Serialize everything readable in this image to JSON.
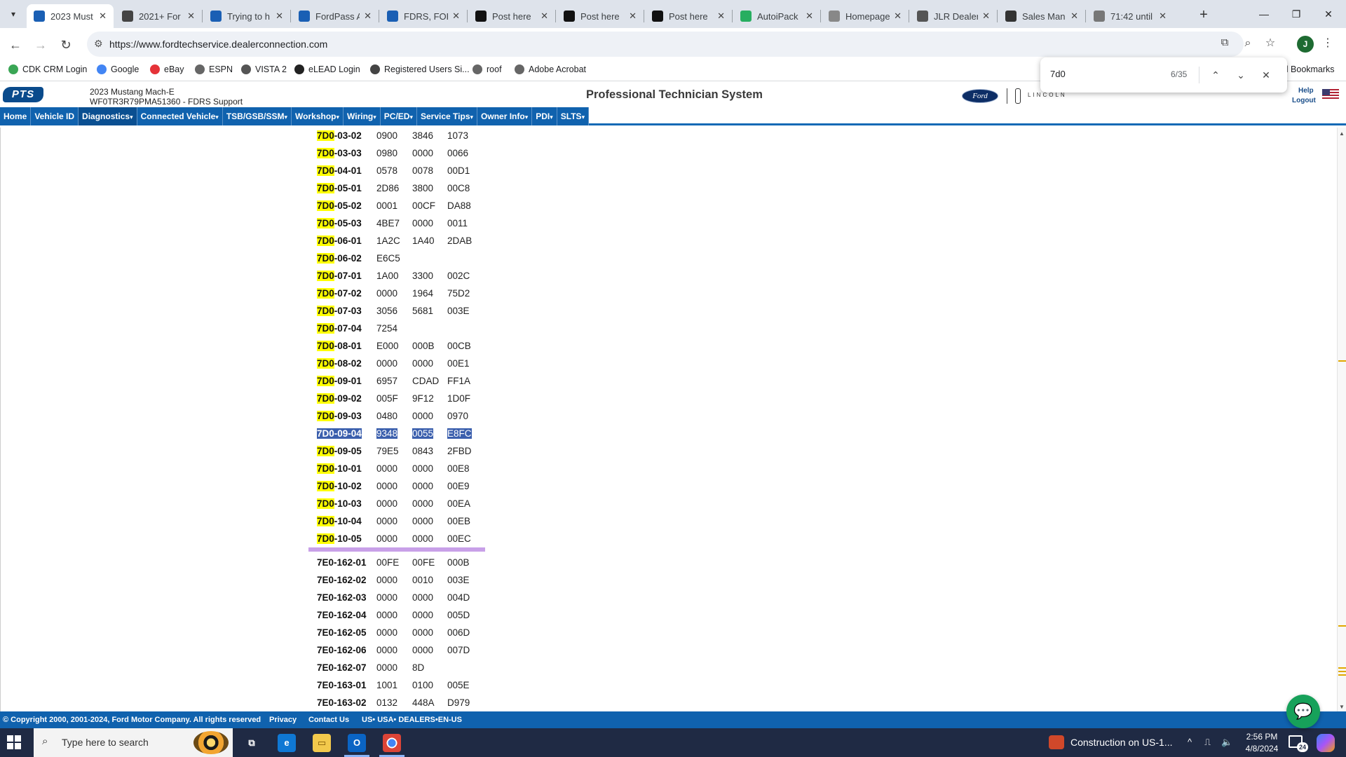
{
  "browser": {
    "tabs": [
      {
        "title": "2023 Must",
        "favicon": "pts-icon",
        "color": "#1a5fb4",
        "active": true
      },
      {
        "title": "2021+ For",
        "favicon": "document-icon",
        "color": "#444444"
      },
      {
        "title": "Trying to h",
        "favicon": "forum-icon",
        "color": "#1a5fb4"
      },
      {
        "title": "FordPass A",
        "favicon": "pts-icon",
        "color": "#1a5fb4"
      },
      {
        "title": "FDRS, FOR",
        "favicon": "pts-icon",
        "color": "#1a5fb4"
      },
      {
        "title": "Post here",
        "favicon": "forum-icon",
        "color": "#111111"
      },
      {
        "title": "Post here",
        "favicon": "forum-icon",
        "color": "#111111"
      },
      {
        "title": "Post here",
        "favicon": "forum-icon",
        "color": "#111111"
      },
      {
        "title": "AutoiPack",
        "favicon": "autoipacket-icon",
        "color": "#27ae60"
      },
      {
        "title": "Homepage",
        "favicon": "jlr-icon",
        "color": "#888888"
      },
      {
        "title": "JLR Dealer",
        "favicon": "globe-icon",
        "color": "#555555"
      },
      {
        "title": "Sales Man",
        "favicon": "grid-icon",
        "color": "#333333"
      },
      {
        "title": "71:42 until",
        "favicon": "timer-icon",
        "color": "#777777"
      }
    ],
    "url": "https://www.fordtechservice.dealerconnection.com",
    "profile_initial": "J",
    "bookmarks": [
      {
        "label": "CDK CRM Login",
        "icon": "cdk-icon",
        "color": "#3aa655"
      },
      {
        "label": "Google",
        "icon": "google-icon",
        "color": "#4285f4"
      },
      {
        "label": "eBay",
        "icon": "ebay-icon",
        "color": "#e53238"
      },
      {
        "label": "ESPN",
        "icon": "globe-icon",
        "color": "#666666"
      },
      {
        "label": "VISTA 2",
        "icon": "vista-icon",
        "color": "#555555"
      },
      {
        "label": "eLEAD Login",
        "icon": "elead-icon",
        "color": "#222222"
      },
      {
        "label": "Registered Users Si...",
        "icon": "arrow-icon",
        "color": "#444444"
      },
      {
        "label": "roof",
        "icon": "globe-icon",
        "color": "#666666"
      },
      {
        "label": "Adobe Acrobat",
        "icon": "globe-icon",
        "color": "#666666"
      }
    ],
    "all_bookmarks": "ll Bookmarks",
    "find": {
      "query": "7d0",
      "count": "6/35"
    }
  },
  "pts": {
    "logo": "PTS",
    "vehicle_name": "2023 Mustang Mach-E",
    "vehicle_vin": "WF0TR3R79PMA51360 - FDRS Support",
    "title": "Professional Technician System",
    "ford_logo": "Ford",
    "lincoln_logo": "LINCOLN",
    "help": "Help",
    "logout": "Logout",
    "menu": [
      {
        "label": "Home",
        "selected": false
      },
      {
        "label": "Vehicle ID",
        "selected": false
      },
      {
        "label": "Diagnostics",
        "selected": true
      },
      {
        "label": "Connected Vehicle",
        "selected": false
      },
      {
        "label": "TSB/GSB/SSM",
        "selected": false
      },
      {
        "label": "Workshop",
        "selected": false
      },
      {
        "label": "Wiring",
        "selected": false
      },
      {
        "label": "PC/ED",
        "selected": false
      },
      {
        "label": "Service Tips",
        "selected": false
      },
      {
        "label": "Owner Info",
        "selected": false
      },
      {
        "label": "PDI",
        "selected": false
      },
      {
        "label": "SLTS",
        "selected": false
      }
    ],
    "menu_dropdown_marker": "▾"
  },
  "data_rows": [
    {
      "prefix": "7D0",
      "suffix": "-03-02",
      "vals": [
        "0900",
        "3846",
        "1073"
      ]
    },
    {
      "prefix": "7D0",
      "suffix": "-03-03",
      "vals": [
        "0980",
        "0000",
        "0066"
      ]
    },
    {
      "prefix": "7D0",
      "suffix": "-04-01",
      "vals": [
        "0578",
        "0078",
        "00D1"
      ]
    },
    {
      "prefix": "7D0",
      "suffix": "-05-01",
      "vals": [
        "2D86",
        "3800",
        "00C8"
      ]
    },
    {
      "prefix": "7D0",
      "suffix": "-05-02",
      "vals": [
        "0001",
        "00CF",
        "DA88"
      ]
    },
    {
      "prefix": "7D0",
      "suffix": "-05-03",
      "vals": [
        "4BE7",
        "0000",
        "0011"
      ]
    },
    {
      "prefix": "7D0",
      "suffix": "-06-01",
      "vals": [
        "1A2C",
        "1A40",
        "2DAB"
      ]
    },
    {
      "prefix": "7D0",
      "suffix": "-06-02",
      "vals": [
        "E6C5"
      ]
    },
    {
      "prefix": "7D0",
      "suffix": "-07-01",
      "vals": [
        "1A00",
        "3300",
        "002C"
      ]
    },
    {
      "prefix": "7D0",
      "suffix": "-07-02",
      "vals": [
        "0000",
        "1964",
        "75D2"
      ]
    },
    {
      "prefix": "7D0",
      "suffix": "-07-03",
      "vals": [
        "3056",
        "5681",
        "003E"
      ]
    },
    {
      "prefix": "7D0",
      "suffix": "-07-04",
      "vals": [
        "7254"
      ]
    },
    {
      "prefix": "7D0",
      "suffix": "-08-01",
      "vals": [
        "E000",
        "000B",
        "00CB"
      ]
    },
    {
      "prefix": "7D0",
      "suffix": "-08-02",
      "vals": [
        "0000",
        "0000",
        "00E1"
      ]
    },
    {
      "prefix": "7D0",
      "suffix": "-09-01",
      "vals": [
        "6957",
        "CDAD",
        "FF1A"
      ]
    },
    {
      "prefix": "7D0",
      "suffix": "-09-02",
      "vals": [
        "005F",
        "9F12",
        "1D0F"
      ]
    },
    {
      "prefix": "7D0",
      "suffix": "-09-03",
      "vals": [
        "0480",
        "0000",
        "0970"
      ]
    },
    {
      "prefix": "7D0",
      "suffix": "-09-04",
      "vals": [
        "9348",
        "0055",
        "E8FC"
      ],
      "current": true
    },
    {
      "prefix": "7D0",
      "suffix": "-09-05",
      "vals": [
        "79E5",
        "0843",
        "2FBD"
      ]
    },
    {
      "prefix": "7D0",
      "suffix": "-10-01",
      "vals": [
        "0000",
        "0000",
        "00E8"
      ]
    },
    {
      "prefix": "7D0",
      "suffix": "-10-02",
      "vals": [
        "0000",
        "0000",
        "00E9"
      ]
    },
    {
      "prefix": "7D0",
      "suffix": "-10-03",
      "vals": [
        "0000",
        "0000",
        "00EA"
      ]
    },
    {
      "prefix": "7D0",
      "suffix": "-10-04",
      "vals": [
        "0000",
        "0000",
        "00EB"
      ]
    },
    {
      "prefix": "7D0",
      "suffix": "-10-05",
      "vals": [
        "0000",
        "0000",
        "00EC"
      ]
    },
    {
      "prefix": "",
      "suffix": "7E0-162-01",
      "vals": [
        "00FE",
        "00FE",
        "000B"
      ],
      "after_divider": true
    },
    {
      "prefix": "",
      "suffix": "7E0-162-02",
      "vals": [
        "0000",
        "0010",
        "003E"
      ]
    },
    {
      "prefix": "",
      "suffix": "7E0-162-03",
      "vals": [
        "0000",
        "0000",
        "004D"
      ]
    },
    {
      "prefix": "",
      "suffix": "7E0-162-04",
      "vals": [
        "0000",
        "0000",
        "005D"
      ]
    },
    {
      "prefix": "",
      "suffix": "7E0-162-05",
      "vals": [
        "0000",
        "0000",
        "006D"
      ]
    },
    {
      "prefix": "",
      "suffix": "7E0-162-06",
      "vals": [
        "0000",
        "0000",
        "007D"
      ]
    },
    {
      "prefix": "",
      "suffix": "7E0-162-07",
      "vals": [
        "0000",
        "8D"
      ]
    },
    {
      "prefix": "",
      "suffix": "7E0-163-01",
      "vals": [
        "1001",
        "0100",
        "005E"
      ]
    },
    {
      "prefix": "",
      "suffix": "7E0-163-02",
      "vals": [
        "0132",
        "448A",
        "D979"
      ]
    }
  ],
  "footer": {
    "copyright": "© Copyright 2000, 2001-2024, Ford Motor Company. All rights reserved",
    "privacy": "Privacy",
    "contact": "Contact Us",
    "locale": "US• USA• DEALERS•EN-US"
  },
  "taskbar": {
    "search_placeholder": "Type here to search",
    "weather": "Construction on US-1...",
    "time": "2:56 PM",
    "date": "4/8/2024",
    "notifications": "24"
  },
  "colors": {
    "menu_blue": "#1062ae",
    "highlight": "#ffff00",
    "current_match": "#3b5fad",
    "divider": "#c8a0e8"
  }
}
